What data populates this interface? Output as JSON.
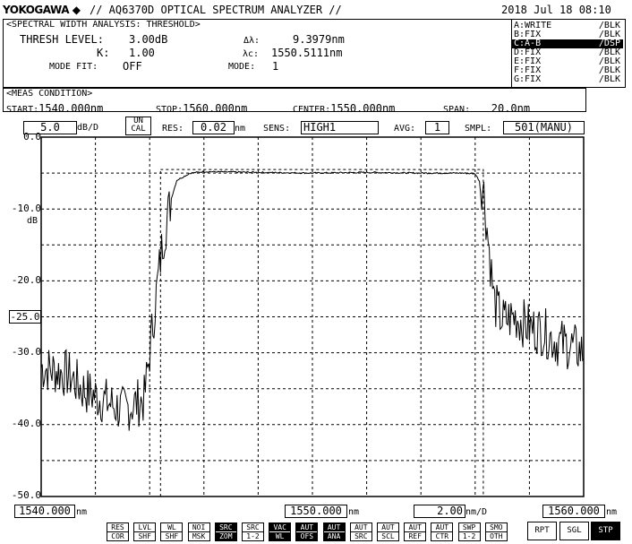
{
  "header": {
    "brand": "YOKOGAWA",
    "model": "// AQ6370D OPTICAL SPECTRUM ANALYZER //",
    "datetime": "2018 Jul 18 08:10"
  },
  "analysis": {
    "title": "<SPECTRAL WIDTH ANALYSIS: THRESHOLD>",
    "thresh_label": "THRESH LEVEL:",
    "thresh_value": "3.00dB",
    "k_label": "K:",
    "k_value": "1.00",
    "mode_fit_label": "MODE FIT:",
    "mode_fit_value": "OFF",
    "dl_label": "Δλ:",
    "dl_value": "9.3979nm",
    "lc_label": "λc:",
    "lc_value": "1550.5111nm",
    "mode_label": "MODE:",
    "mode_value": "1"
  },
  "traces": [
    {
      "name": "A:WRITE",
      "state": "/BLK",
      "active": false
    },
    {
      "name": "B:FIX",
      "state": "/BLK",
      "active": false
    },
    {
      "name": "C:A-B",
      "state": "/DSP",
      "active": true
    },
    {
      "name": "D:FIX",
      "state": "/BLK",
      "active": false
    },
    {
      "name": "E:FIX",
      "state": "/BLK",
      "active": false
    },
    {
      "name": "F:FIX",
      "state": "/BLK",
      "active": false
    },
    {
      "name": "G:FIX",
      "state": "/BLK",
      "active": false
    }
  ],
  "meas": {
    "title": "<MEAS CONDITION>",
    "start_label": "START:",
    "start_value": "1540.000nm",
    "stop_label": "STOP:",
    "stop_value": "1560.000nm",
    "center_label": "CENTER:",
    "center_value": "1550.000nm",
    "span_label": "SPAN:",
    "span_value": "20.0nm"
  },
  "settings": {
    "scale_value": "5.0",
    "scale_unit": "dB/D",
    "uncal_top": "UN",
    "uncal_bottom": "CAL",
    "res_label": "RES:",
    "res_value": "0.02",
    "res_unit": "nm",
    "sens_label": "SENS:",
    "sens_value": "HIGH1",
    "avg_label": "AVG:",
    "avg_value": "1",
    "smpl_label": "SMPL:",
    "smpl_value": "501(MANU)"
  },
  "y_axis": {
    "unit": "dB",
    "ticks": [
      "0.0",
      "-10.0",
      "-20.0",
      "-30.0",
      "-40.0",
      "-50.0"
    ],
    "ref_marker": "-25.0"
  },
  "x_axis": {
    "start": "1540.000",
    "center": "1550.000",
    "stop": "1560.000",
    "unit": "nm",
    "per_div": "2.00",
    "per_div_unit": "nm/D"
  },
  "softkeys": [
    {
      "top": "RES",
      "bottom": "COR",
      "active": false
    },
    {
      "top": "LVL",
      "bottom": "SHF",
      "active": false
    },
    {
      "top": "WL",
      "bottom": "SHF",
      "active": false
    },
    {
      "top": "NOI",
      "bottom": "MSK",
      "active": false
    },
    {
      "top": "SRC",
      "bottom": "ZOM",
      "active": true
    },
    {
      "top": "SRC",
      "bottom": "1-2",
      "active": false
    },
    {
      "top": "VAC",
      "bottom": "WL",
      "active": true
    },
    {
      "top": "AUT",
      "bottom": "OFS",
      "active": true
    },
    {
      "top": "AUT",
      "bottom": "ANA",
      "active": true
    },
    {
      "top": "AUT",
      "bottom": "SRC",
      "active": false
    },
    {
      "top": "AUT",
      "bottom": "SCL",
      "active": false
    },
    {
      "top": "AUT",
      "bottom": "REF",
      "active": false
    },
    {
      "top": "AUT",
      "bottom": "CTR",
      "active": false
    },
    {
      "top": "SWP",
      "bottom": "1-2",
      "active": false
    },
    {
      "top": "SMO",
      "bottom": "OTH",
      "active": false
    }
  ],
  "sweep_keys": [
    {
      "label": "RPT",
      "active": false
    },
    {
      "label": "SGL",
      "active": false
    },
    {
      "label": "STP",
      "active": true
    }
  ],
  "chart_data": {
    "type": "line",
    "x_range": [
      1540.0,
      1560.0
    ],
    "y_range": [
      -50.0,
      0.0
    ],
    "grid": true,
    "threshold_level": -25.0,
    "threshold_box": {
      "x": [
        1544.4,
        1556.3
      ],
      "top": -4.5
    },
    "x": [
      1540.0,
      1541.0,
      1541.5,
      1542.0,
      1542.5,
      1543.0,
      1543.5,
      1543.8,
      1544.0,
      1544.3,
      1544.5,
      1544.8,
      1545.0,
      1545.5,
      1546.0,
      1548.0,
      1550.0,
      1552.0,
      1554.0,
      1555.5,
      1556.0,
      1556.3,
      1556.5,
      1556.7,
      1557.0,
      1557.5,
      1558.0,
      1558.5,
      1559.0,
      1559.5,
      1560.0
    ],
    "y": [
      -32.0,
      -33.0,
      -35.0,
      -36.0,
      -37.0,
      -38.0,
      -37.0,
      -36.5,
      -30.0,
      -20.0,
      -14.0,
      -8.5,
      -6.0,
      -5.0,
      -4.8,
      -4.9,
      -5.0,
      -4.9,
      -5.0,
      -5.0,
      -5.1,
      -7.0,
      -15.0,
      -23.0,
      -25.5,
      -25.0,
      -26.5,
      -27.0,
      -28.5,
      -29.0,
      -30.0
    ]
  }
}
